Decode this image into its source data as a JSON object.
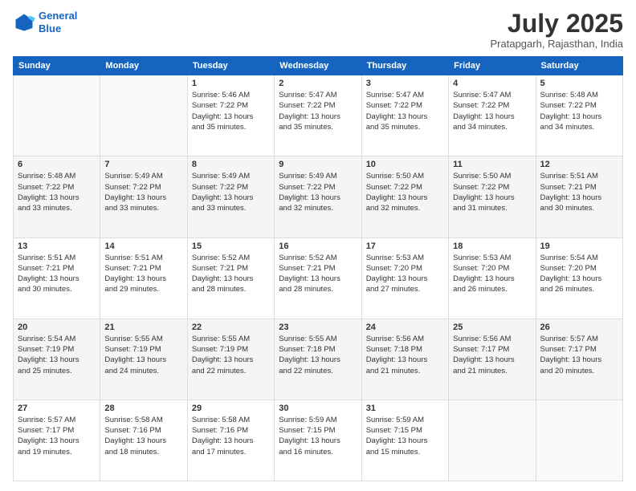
{
  "header": {
    "logo_line1": "General",
    "logo_line2": "Blue",
    "month": "July 2025",
    "location": "Pratapgarh, Rajasthan, India"
  },
  "days_of_week": [
    "Sunday",
    "Monday",
    "Tuesday",
    "Wednesday",
    "Thursday",
    "Friday",
    "Saturday"
  ],
  "weeks": [
    [
      {
        "day": "",
        "info": ""
      },
      {
        "day": "",
        "info": ""
      },
      {
        "day": "1",
        "info": "Sunrise: 5:46 AM\nSunset: 7:22 PM\nDaylight: 13 hours\nand 35 minutes."
      },
      {
        "day": "2",
        "info": "Sunrise: 5:47 AM\nSunset: 7:22 PM\nDaylight: 13 hours\nand 35 minutes."
      },
      {
        "day": "3",
        "info": "Sunrise: 5:47 AM\nSunset: 7:22 PM\nDaylight: 13 hours\nand 35 minutes."
      },
      {
        "day": "4",
        "info": "Sunrise: 5:47 AM\nSunset: 7:22 PM\nDaylight: 13 hours\nand 34 minutes."
      },
      {
        "day": "5",
        "info": "Sunrise: 5:48 AM\nSunset: 7:22 PM\nDaylight: 13 hours\nand 34 minutes."
      }
    ],
    [
      {
        "day": "6",
        "info": "Sunrise: 5:48 AM\nSunset: 7:22 PM\nDaylight: 13 hours\nand 33 minutes."
      },
      {
        "day": "7",
        "info": "Sunrise: 5:49 AM\nSunset: 7:22 PM\nDaylight: 13 hours\nand 33 minutes."
      },
      {
        "day": "8",
        "info": "Sunrise: 5:49 AM\nSunset: 7:22 PM\nDaylight: 13 hours\nand 33 minutes."
      },
      {
        "day": "9",
        "info": "Sunrise: 5:49 AM\nSunset: 7:22 PM\nDaylight: 13 hours\nand 32 minutes."
      },
      {
        "day": "10",
        "info": "Sunrise: 5:50 AM\nSunset: 7:22 PM\nDaylight: 13 hours\nand 32 minutes."
      },
      {
        "day": "11",
        "info": "Sunrise: 5:50 AM\nSunset: 7:22 PM\nDaylight: 13 hours\nand 31 minutes."
      },
      {
        "day": "12",
        "info": "Sunrise: 5:51 AM\nSunset: 7:21 PM\nDaylight: 13 hours\nand 30 minutes."
      }
    ],
    [
      {
        "day": "13",
        "info": "Sunrise: 5:51 AM\nSunset: 7:21 PM\nDaylight: 13 hours\nand 30 minutes."
      },
      {
        "day": "14",
        "info": "Sunrise: 5:51 AM\nSunset: 7:21 PM\nDaylight: 13 hours\nand 29 minutes."
      },
      {
        "day": "15",
        "info": "Sunrise: 5:52 AM\nSunset: 7:21 PM\nDaylight: 13 hours\nand 28 minutes."
      },
      {
        "day": "16",
        "info": "Sunrise: 5:52 AM\nSunset: 7:21 PM\nDaylight: 13 hours\nand 28 minutes."
      },
      {
        "day": "17",
        "info": "Sunrise: 5:53 AM\nSunset: 7:20 PM\nDaylight: 13 hours\nand 27 minutes."
      },
      {
        "day": "18",
        "info": "Sunrise: 5:53 AM\nSunset: 7:20 PM\nDaylight: 13 hours\nand 26 minutes."
      },
      {
        "day": "19",
        "info": "Sunrise: 5:54 AM\nSunset: 7:20 PM\nDaylight: 13 hours\nand 26 minutes."
      }
    ],
    [
      {
        "day": "20",
        "info": "Sunrise: 5:54 AM\nSunset: 7:19 PM\nDaylight: 13 hours\nand 25 minutes."
      },
      {
        "day": "21",
        "info": "Sunrise: 5:55 AM\nSunset: 7:19 PM\nDaylight: 13 hours\nand 24 minutes."
      },
      {
        "day": "22",
        "info": "Sunrise: 5:55 AM\nSunset: 7:19 PM\nDaylight: 13 hours\nand 22 minutes."
      },
      {
        "day": "23",
        "info": "Sunrise: 5:55 AM\nSunset: 7:18 PM\nDaylight: 13 hours\nand 22 minutes."
      },
      {
        "day": "24",
        "info": "Sunrise: 5:56 AM\nSunset: 7:18 PM\nDaylight: 13 hours\nand 21 minutes."
      },
      {
        "day": "25",
        "info": "Sunrise: 5:56 AM\nSunset: 7:17 PM\nDaylight: 13 hours\nand 21 minutes."
      },
      {
        "day": "26",
        "info": "Sunrise: 5:57 AM\nSunset: 7:17 PM\nDaylight: 13 hours\nand 20 minutes."
      }
    ],
    [
      {
        "day": "27",
        "info": "Sunrise: 5:57 AM\nSunset: 7:17 PM\nDaylight: 13 hours\nand 19 minutes."
      },
      {
        "day": "28",
        "info": "Sunrise: 5:58 AM\nSunset: 7:16 PM\nDaylight: 13 hours\nand 18 minutes."
      },
      {
        "day": "29",
        "info": "Sunrise: 5:58 AM\nSunset: 7:16 PM\nDaylight: 13 hours\nand 17 minutes."
      },
      {
        "day": "30",
        "info": "Sunrise: 5:59 AM\nSunset: 7:15 PM\nDaylight: 13 hours\nand 16 minutes."
      },
      {
        "day": "31",
        "info": "Sunrise: 5:59 AM\nSunset: 7:15 PM\nDaylight: 13 hours\nand 15 minutes."
      },
      {
        "day": "",
        "info": ""
      },
      {
        "day": "",
        "info": ""
      }
    ]
  ]
}
